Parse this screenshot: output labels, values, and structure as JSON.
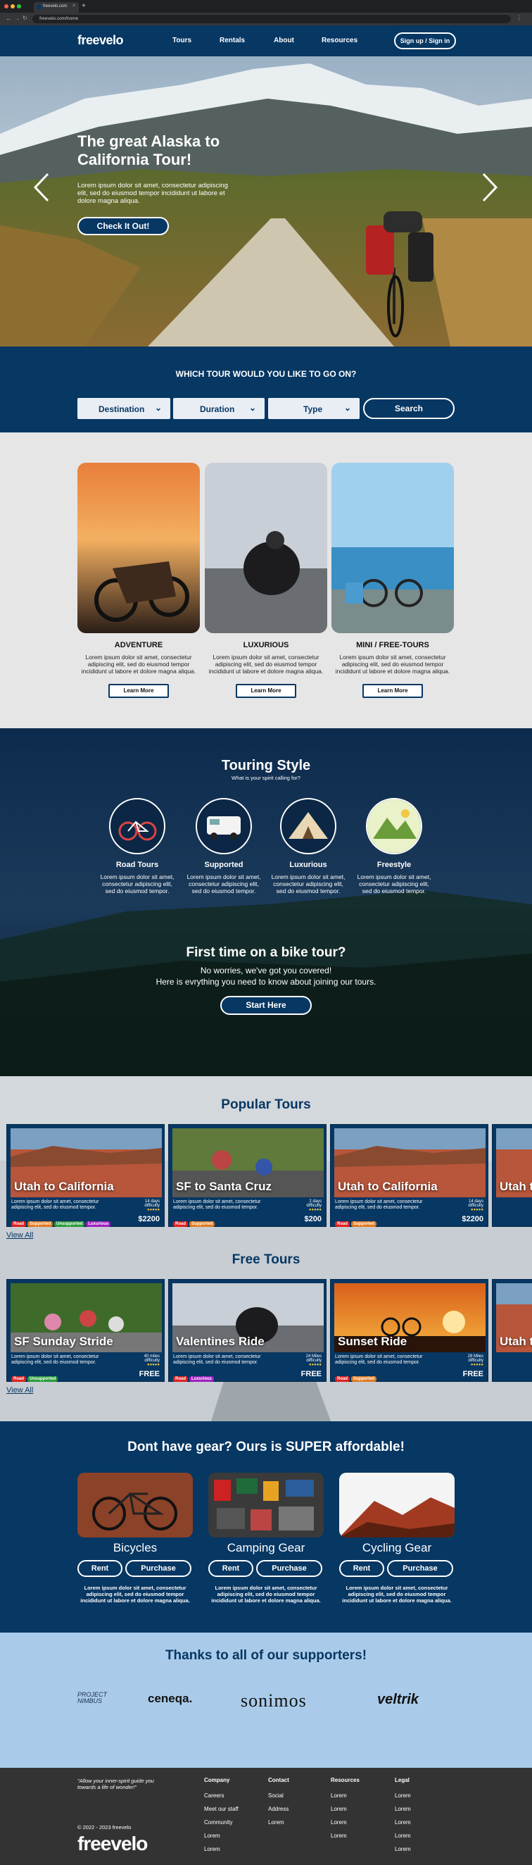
{
  "browser": {
    "tab_title": "freevelo.com",
    "url": "freevelo.com/home"
  },
  "nav": {
    "logo": "freevelo",
    "links": [
      "Tours",
      "Rentals",
      "About",
      "Resources"
    ],
    "signin": "Sign up / Sign in"
  },
  "hero": {
    "title": "The great Alaska to California Tour!",
    "desc": "Lorem ipsum dolor sit amet, consectetur adipiscing elit, sed do eiusmod tempor incididunt ut labore et dolore magna aliqua.",
    "cta": "Check It Out!"
  },
  "search": {
    "heading": "WHICH TOUR WOULD YOU LIKE TO GO ON?",
    "filters": [
      "Destination",
      "Duration",
      "Type"
    ],
    "button": "Search"
  },
  "categories": [
    {
      "title": "ADVENTURE",
      "desc": "Lorem ipsum dolor sit amet, consectetur adipiscing elit, sed do eiusmod tempor incididunt ut labore et dolore magna aliqua.",
      "button": "Learn More"
    },
    {
      "title": "LUXURIOUS",
      "desc": "Lorem ipsum dolor sit amet, consectetur adipiscing elit, sed do eiusmod tempor incididunt ut labore et dolore magna aliqua.",
      "button": "Learn More"
    },
    {
      "title": "MINI / FREE-TOURS",
      "desc": "Lorem ipsum dolor sit amet, consectetur adipiscing elit, sed do eiusmod tempor incididunt ut labore et dolore magna aliqua.",
      "button": "Learn More"
    }
  ],
  "touring": {
    "title": "Touring Style",
    "subtitle": "What is your spirit calling for?",
    "styles": [
      {
        "title": "Road Tours",
        "desc": "Lorem ipsum dolor sit amet, consectetur adipiscing elit, sed do eiusmod tempor."
      },
      {
        "title": "Supported",
        "desc": "Lorem ipsum dolor sit amet, consectetur adipiscing elit, sed do eiusmod tempor."
      },
      {
        "title": "Luxurious",
        "desc": "Lorem ipsum dolor sit amet, consectetur adipiscing elit, sed do eiusmod tempor."
      },
      {
        "title": "Freestyle",
        "desc": "Lorem ipsum dolor sit amet, consectetur adipiscing elit, sed do eiusmod tempor."
      }
    ],
    "first_title": "First time on a bike tour?",
    "first_line1": "No worries, we've got you covered!",
    "first_line2": "Here is evrything you need to know about joining our tours.",
    "first_button": "Start Here"
  },
  "popular": {
    "heading": "Popular Tours",
    "view_all": "View All",
    "cards": [
      {
        "title": "Utah to California",
        "desc": "Lorem ipsum dolor sit amet, consectetur adipiscing elit, sed do eiusmod tempor.",
        "meta": "14 days",
        "difficulty": "difficulty",
        "price": "$2200",
        "tags": [
          "Road",
          "Supported",
          "Unsupported",
          "Luxurious"
        ]
      },
      {
        "title": "SF to Santa Cruz",
        "desc": "Lorem ipsum dolor sit amet, consectetur adipiscing elit, sed do eiusmod tempor.",
        "meta": "2 days",
        "difficulty": "difficulty",
        "price": "$200",
        "tags": [
          "Road",
          "Supported"
        ]
      },
      {
        "title": "Utah to California",
        "desc": "Lorem ipsum dolor sit amet, consectetur adipiscing elit, sed do eiusmod tempor.",
        "meta": "14 days",
        "difficulty": "difficulty",
        "price": "$2200",
        "tags": [
          "Road",
          "Supported"
        ]
      },
      {
        "title": "Utah t"
      }
    ]
  },
  "free": {
    "heading": "Free Tours",
    "view_all": "View All",
    "cards": [
      {
        "title": "SF Sunday Stride",
        "desc": "Lorem ipsum dolor sit amet, consectetur adipiscing elit, sed do eiusmod tempor.",
        "meta": "40 miles",
        "difficulty": "difficulty",
        "price": "FREE",
        "tags": [
          "Road",
          "Unsupported"
        ]
      },
      {
        "title": "Valentines Ride",
        "desc": "Lorem ipsum dolor sit amet, consectetur adipiscing elit, sed do eiusmod tempor.",
        "meta": "24 Miles",
        "difficulty": "difficulty",
        "price": "FREE",
        "tags": [
          "Road",
          "Luxurious"
        ]
      },
      {
        "title": "Sunset Ride",
        "desc": "Lorem ipsum dolor sit amet, consectetur adipiscing elit, sed do eiusmod tempor.",
        "meta": "28 Miles",
        "difficulty": "difficulty",
        "price": "FREE",
        "tags": [
          "Road",
          "Supported"
        ]
      },
      {
        "title": "Utah t"
      }
    ]
  },
  "gear": {
    "heading": "Dont have gear? Ours is SUPER affordable!",
    "items": [
      {
        "title": "Bicycles",
        "rent": "Rent",
        "purchase": "Purchase",
        "desc": "Lorem ipsum dolor sit amet, consectetur adipiscing elit, sed do eiusmod tempor incididunt ut labore et dolore magna aliqua."
      },
      {
        "title": "Camping Gear",
        "rent": "Rent",
        "purchase": "Purchase",
        "desc": "Lorem ipsum dolor sit amet, consectetur adipiscing elit, sed do eiusmod tempor incididunt ut labore et dolore magna aliqua."
      },
      {
        "title": "Cycling Gear",
        "rent": "Rent",
        "purchase": "Purchase",
        "desc": "Lorem ipsum dolor sit amet, consectetur adipiscing elit, sed do eiusmod tempor incididunt ut labore et dolore magna aliqua."
      }
    ]
  },
  "supporters": {
    "heading": "Thanks to all of our supporters!",
    "logos": [
      "PROJECT NIMBUS",
      "ceneqa.",
      "sonimos",
      "veltrik"
    ]
  },
  "footer": {
    "tagline": "\"Allow your inner-spirit guide you towards a life of wonder!\"",
    "copyright": "© 2022 - 2023 freevelo",
    "logo": "freevelo",
    "columns": [
      {
        "heading": "Company",
        "items": [
          "Careers",
          "Meet our staff",
          "Community",
          "Lorem",
          "Lorem"
        ]
      },
      {
        "heading": "Contact",
        "items": [
          "Social",
          "Address",
          "Lorem"
        ]
      },
      {
        "heading": "Resources",
        "items": [
          "Lorem",
          "Lorem",
          "Lorem",
          "Lorem"
        ]
      },
      {
        "heading": "Legal",
        "items": [
          "Lorem",
          "Lorem",
          "Lorem",
          "Lorem",
          "Lorem"
        ]
      }
    ]
  },
  "colors": {
    "navy": "#073763",
    "light_gray": "#e6e6e6",
    "light_blue": "#a9cbe9",
    "footer": "#333333"
  }
}
